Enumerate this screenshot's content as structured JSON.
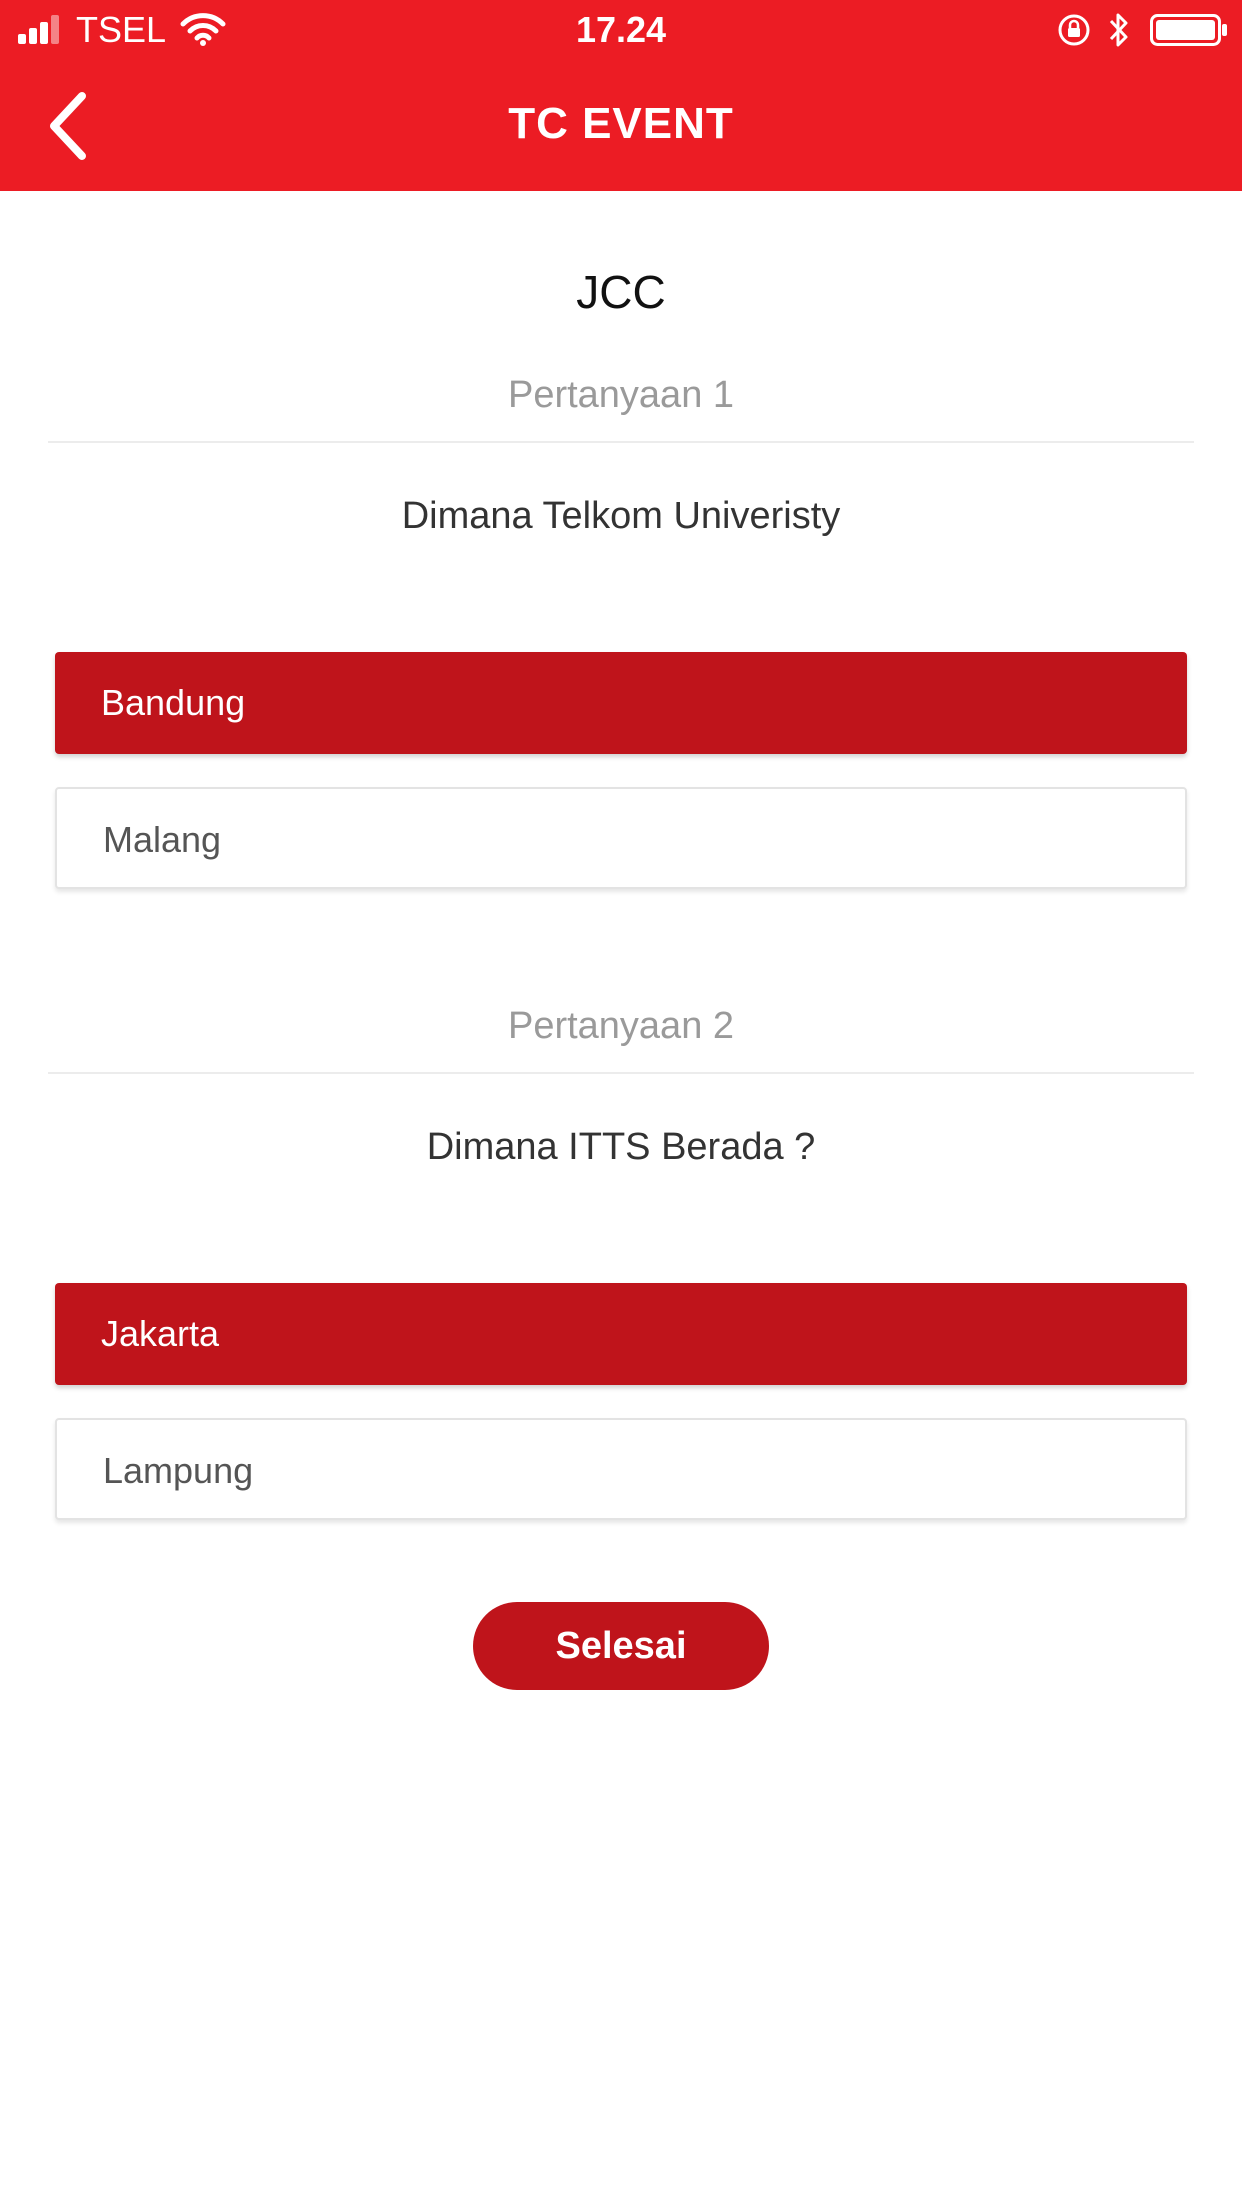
{
  "status_bar": {
    "carrier": "TSEL",
    "time": "17.24",
    "icons": [
      "signal-icon",
      "wifi-icon",
      "orientation-lock-icon",
      "bluetooth-icon",
      "battery-icon"
    ]
  },
  "nav": {
    "title": "TC EVENT",
    "back_icon": "chevron-left-icon"
  },
  "event": {
    "name": "JCC"
  },
  "questions": [
    {
      "label": "Pertanyaan 1",
      "text": "Dimana Telkom Univeristy",
      "options": [
        {
          "label": "Bandung",
          "selected": true
        },
        {
          "label": "Malang",
          "selected": false
        }
      ]
    },
    {
      "label": "Pertanyaan 2",
      "text": "Dimana ITTS Berada ?",
      "options": [
        {
          "label": "Jakarta",
          "selected": true
        },
        {
          "label": "Lampung",
          "selected": false
        }
      ]
    }
  ],
  "finish_button": {
    "label": "Selesai"
  },
  "colors": {
    "header": "#ec1c24",
    "selected_option": "#bf141b",
    "button": "#bf141b"
  }
}
